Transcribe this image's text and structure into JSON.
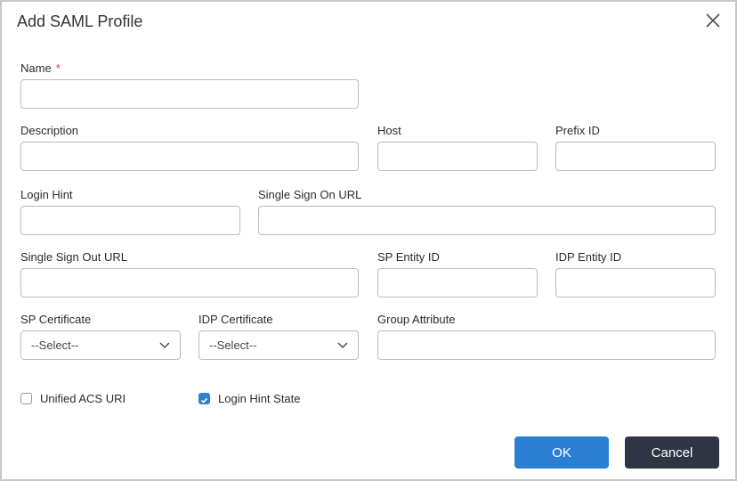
{
  "dialog": {
    "title": "Add SAML Profile"
  },
  "fields": {
    "name": {
      "label": "Name",
      "required": "*",
      "value": ""
    },
    "description": {
      "label": "Description",
      "value": ""
    },
    "host": {
      "label": "Host",
      "value": ""
    },
    "prefix_id": {
      "label": "Prefix ID",
      "value": ""
    },
    "login_hint": {
      "label": "Login Hint",
      "value": ""
    },
    "sso_url": {
      "label": "Single Sign On URL",
      "value": ""
    },
    "slo_url": {
      "label": "Single Sign Out URL",
      "value": ""
    },
    "sp_entity_id": {
      "label": "SP Entity ID",
      "value": ""
    },
    "idp_entity_id": {
      "label": "IDP Entity ID",
      "value": ""
    },
    "sp_certificate": {
      "label": "SP Certificate",
      "selected": "--Select--"
    },
    "idp_certificate": {
      "label": "IDP Certificate",
      "selected": "--Select--"
    },
    "group_attribute": {
      "label": "Group Attribute",
      "value": ""
    }
  },
  "checkboxes": {
    "unified_acs_uri": {
      "label": "Unified ACS URI",
      "checked": false
    },
    "login_hint_state": {
      "label": "Login Hint State",
      "checked": true
    }
  },
  "buttons": {
    "ok": "OK",
    "cancel": "Cancel"
  },
  "colors": {
    "primary": "#2b7fd4",
    "secondary": "#2f3542",
    "required": "#e0334a"
  }
}
